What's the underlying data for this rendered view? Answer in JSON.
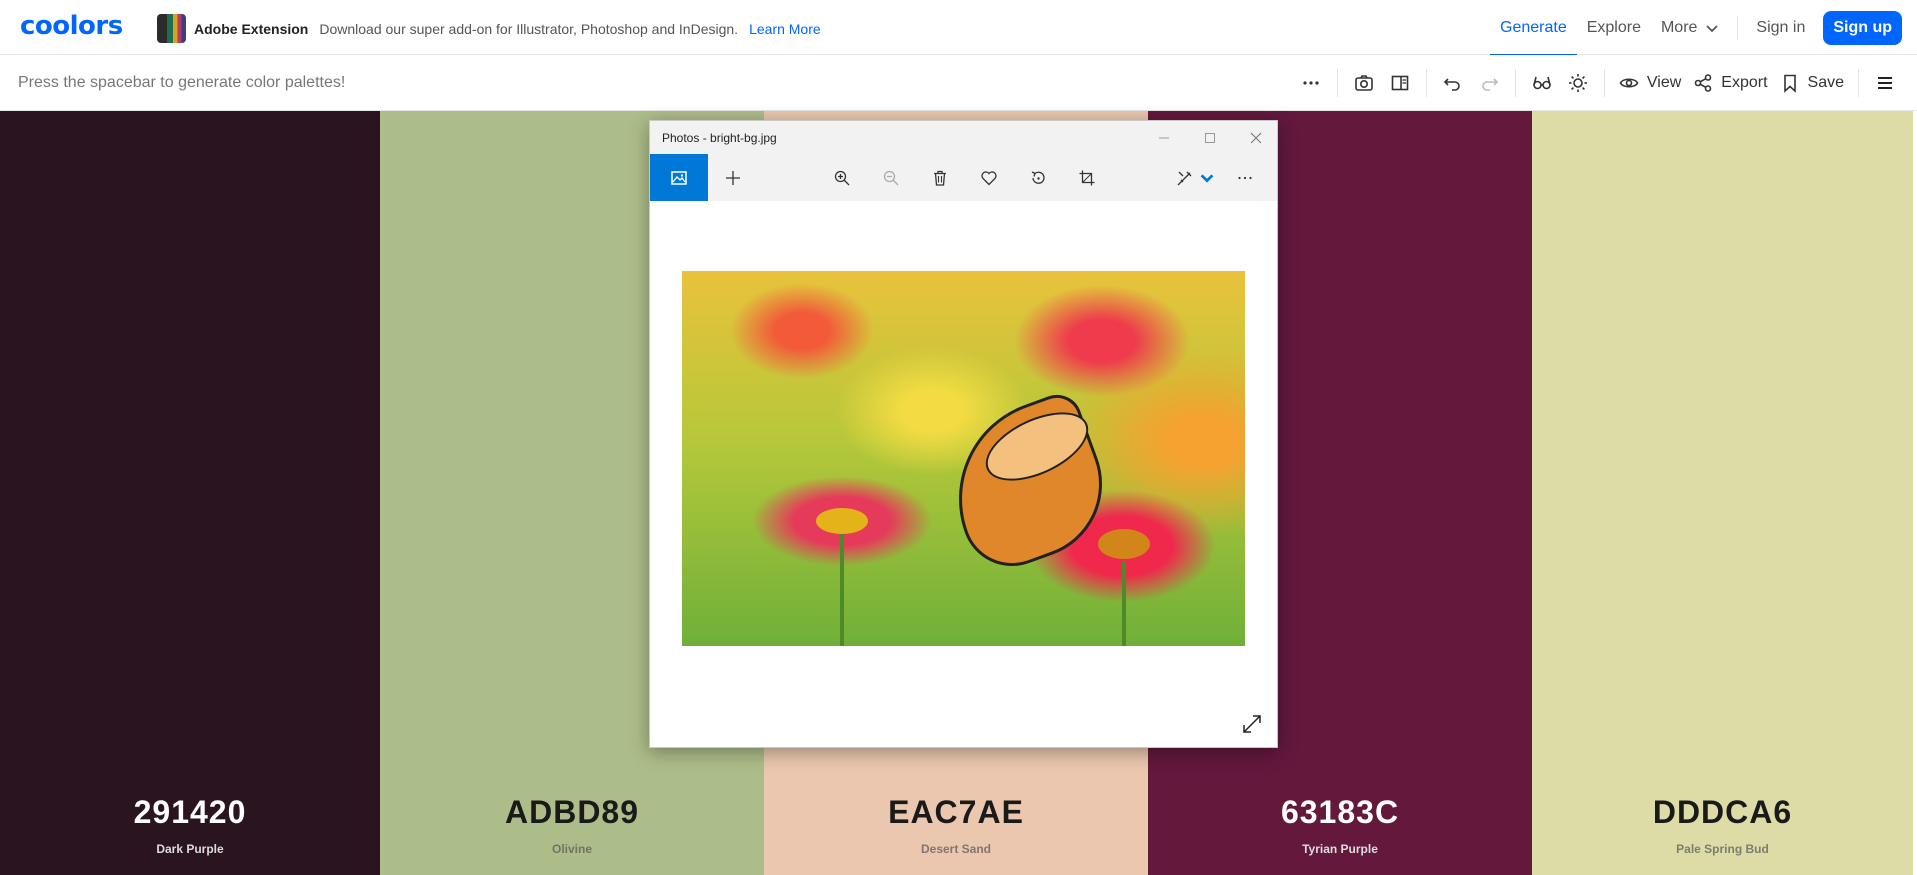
{
  "app": {
    "logo": "coolors"
  },
  "promo": {
    "title": "Adobe Extension",
    "description": "Download our super add-on for Illustrator, Photoshop and InDesign.",
    "link": "Learn More"
  },
  "nav": {
    "generate": "Generate",
    "explore": "Explore",
    "more": "More",
    "signin": "Sign in",
    "signup": "Sign up"
  },
  "toolbar": {
    "hint": "Press the spacebar to generate color palettes!",
    "view": "View",
    "export": "Export",
    "save": "Save"
  },
  "palette": [
    {
      "hex": "291420",
      "name": "Dark Purple",
      "color": "#291420"
    },
    {
      "hex": "ADBD89",
      "name": "Olivine",
      "color": "#ADBD89"
    },
    {
      "hex": "EAC7AE",
      "name": "Desert Sand",
      "color": "#EAC7AE"
    },
    {
      "hex": "63183C",
      "name": "Tyrian Purple",
      "color": "#63183C"
    },
    {
      "hex": "DDDCA6",
      "name": "Pale Spring Bud",
      "color": "#DDDCA6"
    }
  ],
  "photos_window": {
    "title": "Photos - bright-bg.jpg"
  },
  "colors": {
    "accent": "#0066ff",
    "photos_accent": "#0078d7"
  }
}
